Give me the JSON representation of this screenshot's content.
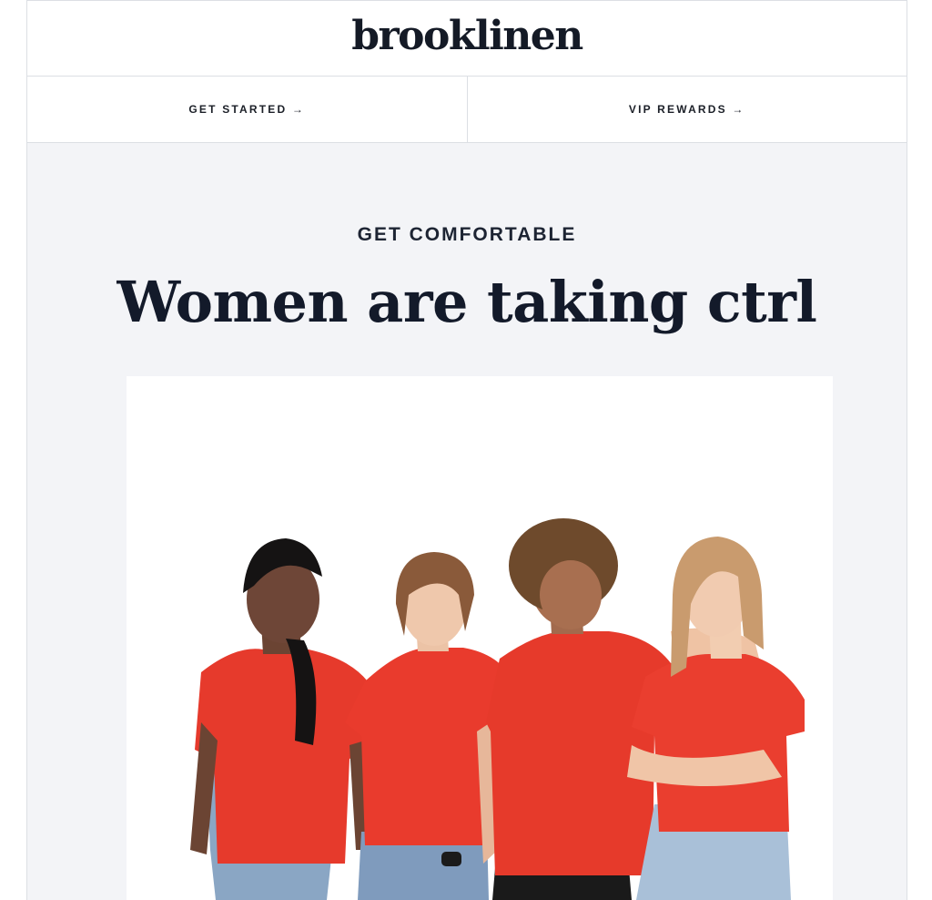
{
  "brand": {
    "logo_text": "brooklinen"
  },
  "nav": {
    "items": [
      {
        "label": "GET STARTED →"
      },
      {
        "label": "VIP REWARDS →"
      }
    ]
  },
  "hero": {
    "eyebrow": "GET COMFORTABLE",
    "headline": "Women are taking ctrl"
  },
  "colors": {
    "background": "#f3f4f7",
    "text_dark": "#131a2a",
    "shirt_red": "#e8392a",
    "denim": "#8fa8c4"
  },
  "hero_image": {
    "icon": "group-photo-image"
  }
}
